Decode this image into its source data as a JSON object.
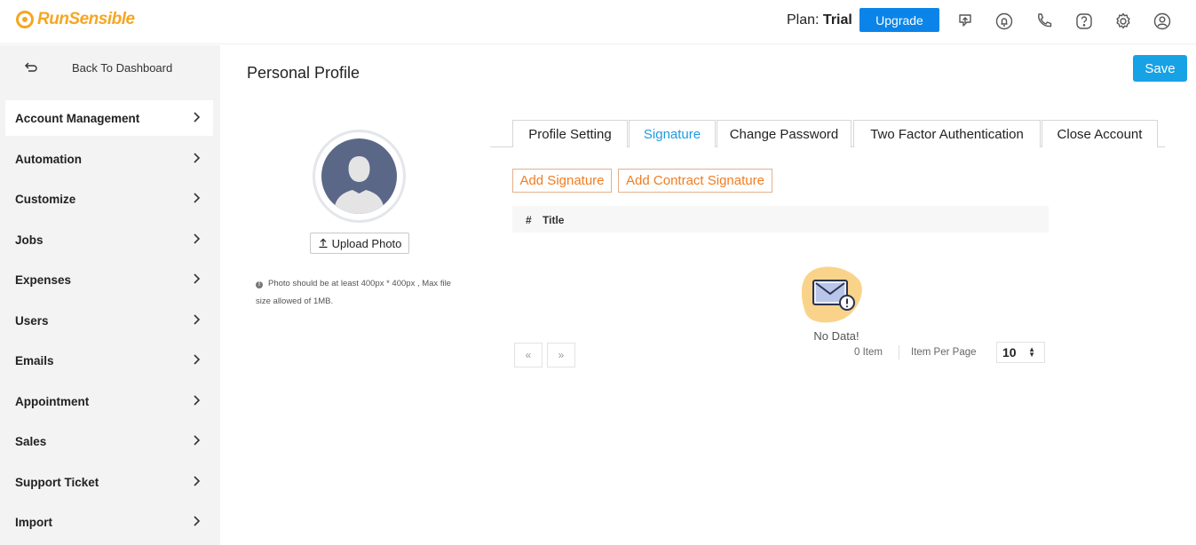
{
  "header": {
    "logo_text": "RunSensible",
    "plan_label": "Plan:",
    "plan_value": "Trial",
    "upgrade_label": "Upgrade",
    "icons": [
      "feedback-icon",
      "notification-icon",
      "phone-icon",
      "help-icon",
      "settings-icon",
      "user-icon"
    ]
  },
  "sidebar": {
    "back_label": "Back To Dashboard",
    "items": [
      {
        "label": "Account Management",
        "active": true
      },
      {
        "label": "Automation"
      },
      {
        "label": "Customize"
      },
      {
        "label": "Jobs"
      },
      {
        "label": "Expenses"
      },
      {
        "label": "Users"
      },
      {
        "label": "Emails"
      },
      {
        "label": "Appointment"
      },
      {
        "label": "Sales"
      },
      {
        "label": "Support Ticket"
      },
      {
        "label": "Import"
      }
    ]
  },
  "main": {
    "title": "Personal Profile",
    "save_label": "Save",
    "upload_label": "Upload Photo",
    "photo_note": "Photo should be at least 400px * 400px , Max file size allowed of 1MB.",
    "tabs": [
      {
        "label": "Profile Setting"
      },
      {
        "label": "Signature",
        "active": true
      },
      {
        "label": "Change Password"
      },
      {
        "label": "Two Factor Authentication"
      },
      {
        "label": "Close Account"
      }
    ],
    "add_signature_label": "Add Signature",
    "add_contract_signature_label": "Add Contract Signature",
    "table": {
      "columns": [
        "#",
        "Title"
      ],
      "rows": []
    },
    "empty_text": "No Data!",
    "pagination": {
      "prev": "«",
      "next": "»",
      "item_count": "0 Item",
      "per_page_label": "Item Per Page",
      "per_page_value": "10"
    }
  },
  "colors": {
    "brand": "#f5a623",
    "upgrade": "#0a84e8",
    "save": "#17a2e6",
    "active_tab": "#1e9be0",
    "outline_btn_text": "#ef7d22"
  }
}
